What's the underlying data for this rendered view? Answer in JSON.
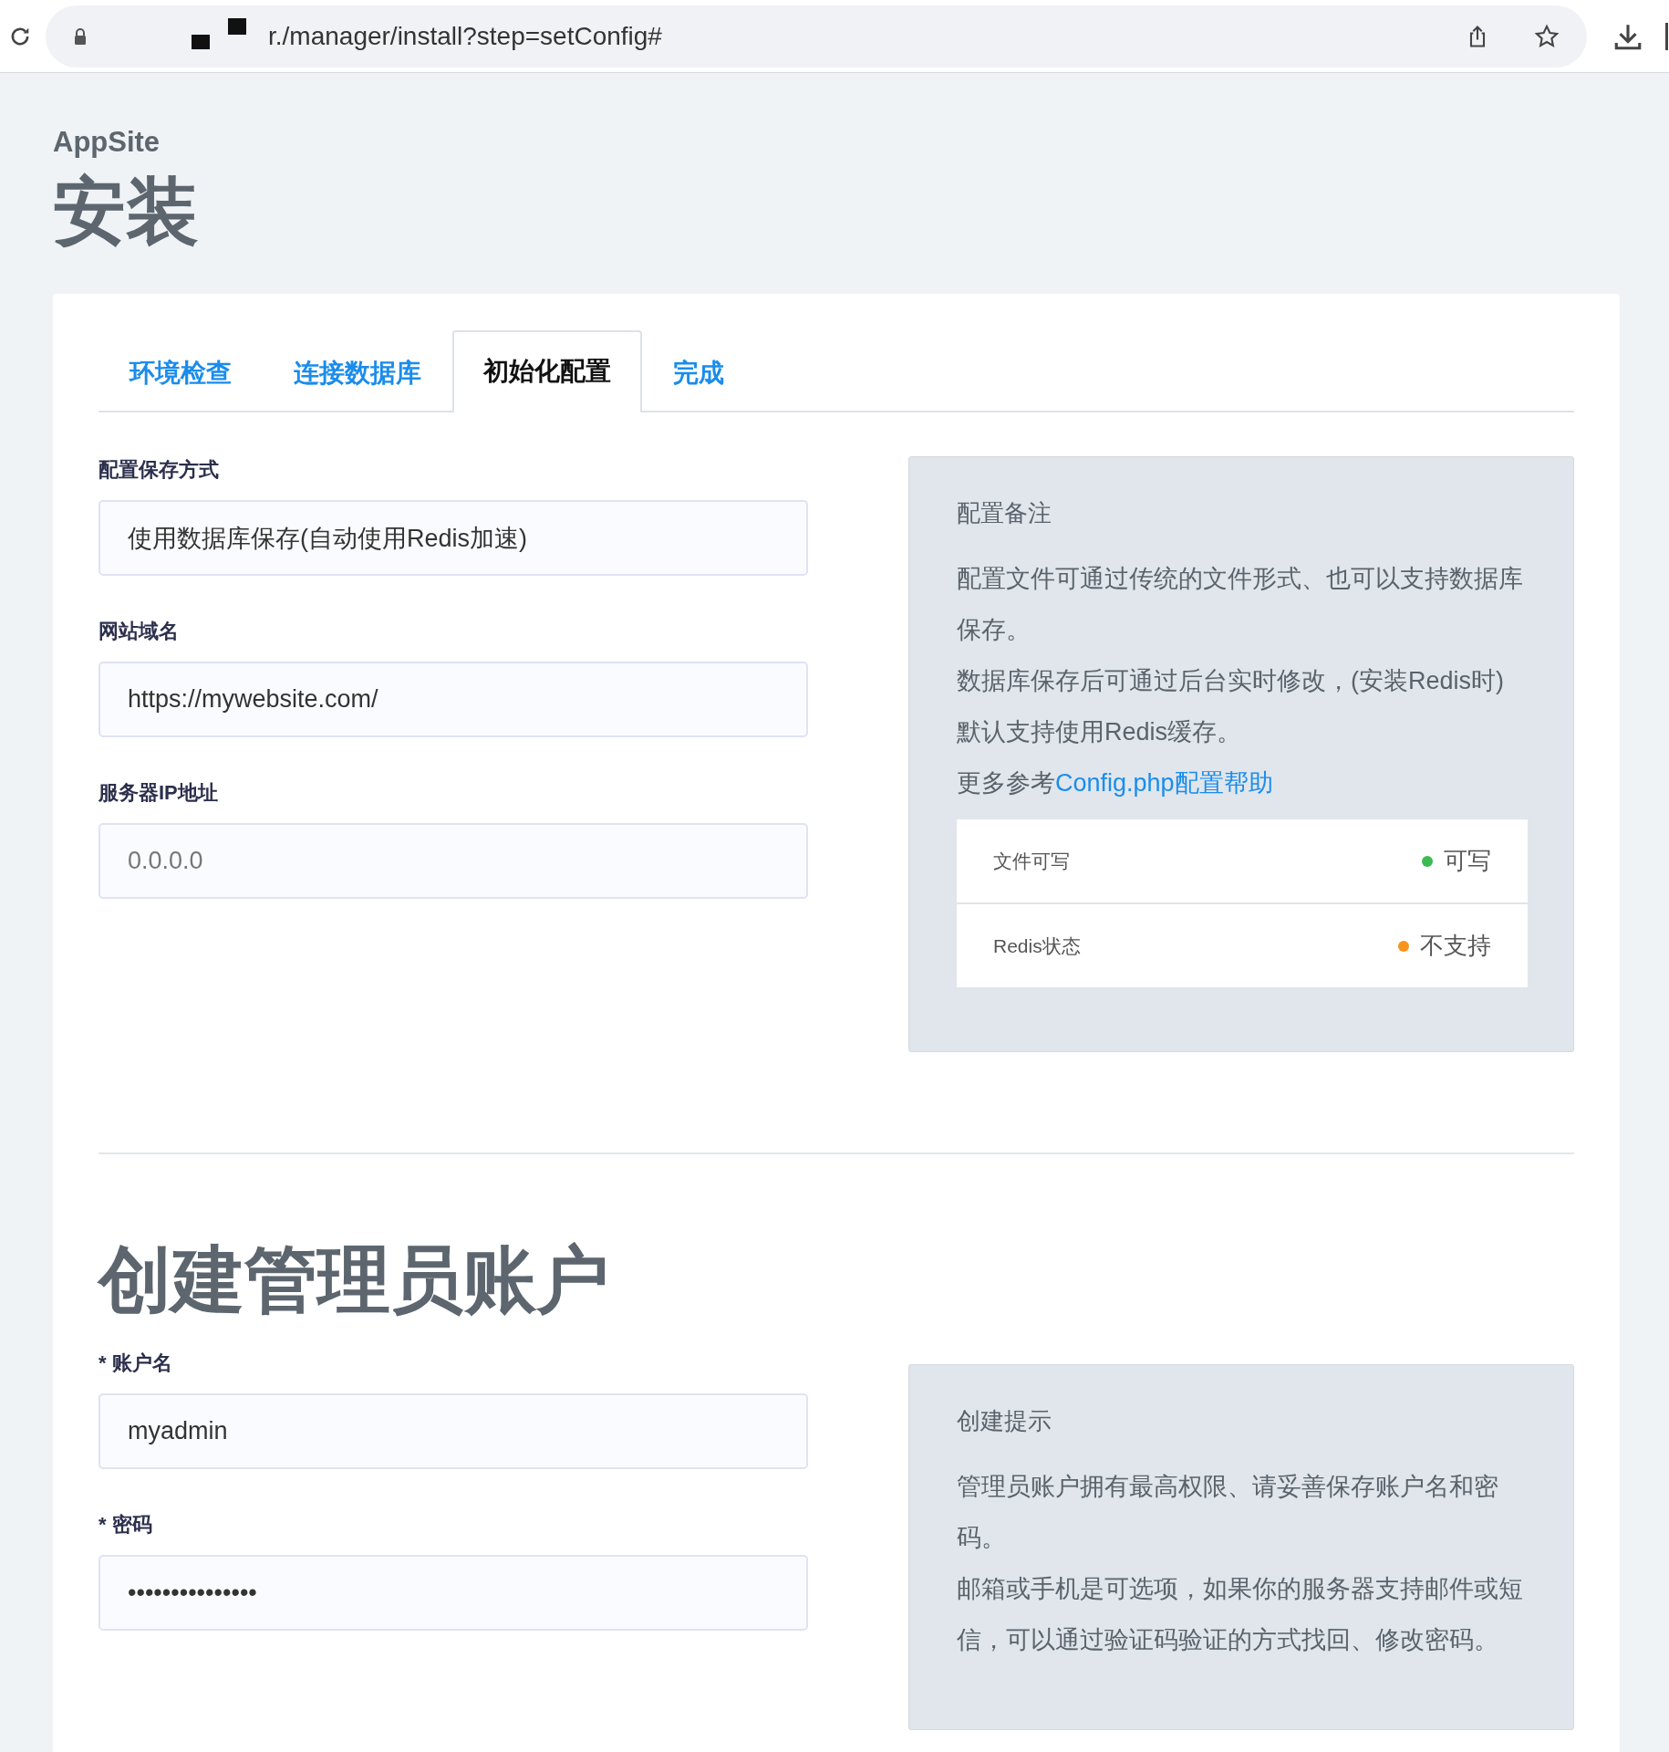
{
  "browser": {
    "url": "r./manager/install?step=setConfig#"
  },
  "site_name": "AppSite",
  "page_title": "安装",
  "tabs": [
    {
      "label": "环境检查",
      "selected": false
    },
    {
      "label": "连接数据库",
      "selected": false
    },
    {
      "label": "初始化配置",
      "selected": true
    },
    {
      "label": "完成",
      "selected": false
    }
  ],
  "config_fields": [
    {
      "label": "配置保存方式",
      "value": "使用数据库保存(自动使用Redis加速)"
    },
    {
      "label": "网站域名",
      "value": "https://mywebsite.com/"
    },
    {
      "label": "服务器IP地址",
      "placeholder": "0.0.0.0"
    }
  ],
  "config_note": {
    "title": "配置备注",
    "paragraphs": [
      "配置文件可通过传统的文件形式、也可以支持数据库保存。",
      "数据库保存后可通过后台实时修改，(安装Redis时)默认支持使用Redis缓存。"
    ],
    "link_prefix": "更多参考",
    "link": "Config.php配置帮助",
    "status": [
      {
        "name": "文件可写",
        "value": "可写",
        "color": "#3cba54"
      },
      {
        "name": "Redis状态",
        "value": "不支持",
        "color": "#f7931e"
      }
    ]
  },
  "admin_title": "创建管理员账户",
  "admin_fields": [
    {
      "label": "* 账户名",
      "value": "myadmin"
    },
    {
      "label": "* 密码",
      "value": "•••••••••••••••"
    }
  ],
  "admin_note": {
    "title": "创建提示",
    "paragraphs": [
      "管理员账户拥有最高权限、请妥善保存账户名和密码。",
      "邮箱或手机是可选项，如果你的服务器支持邮件或短信，可以通过验证码验证的方式找回、修改密码。"
    ]
  }
}
